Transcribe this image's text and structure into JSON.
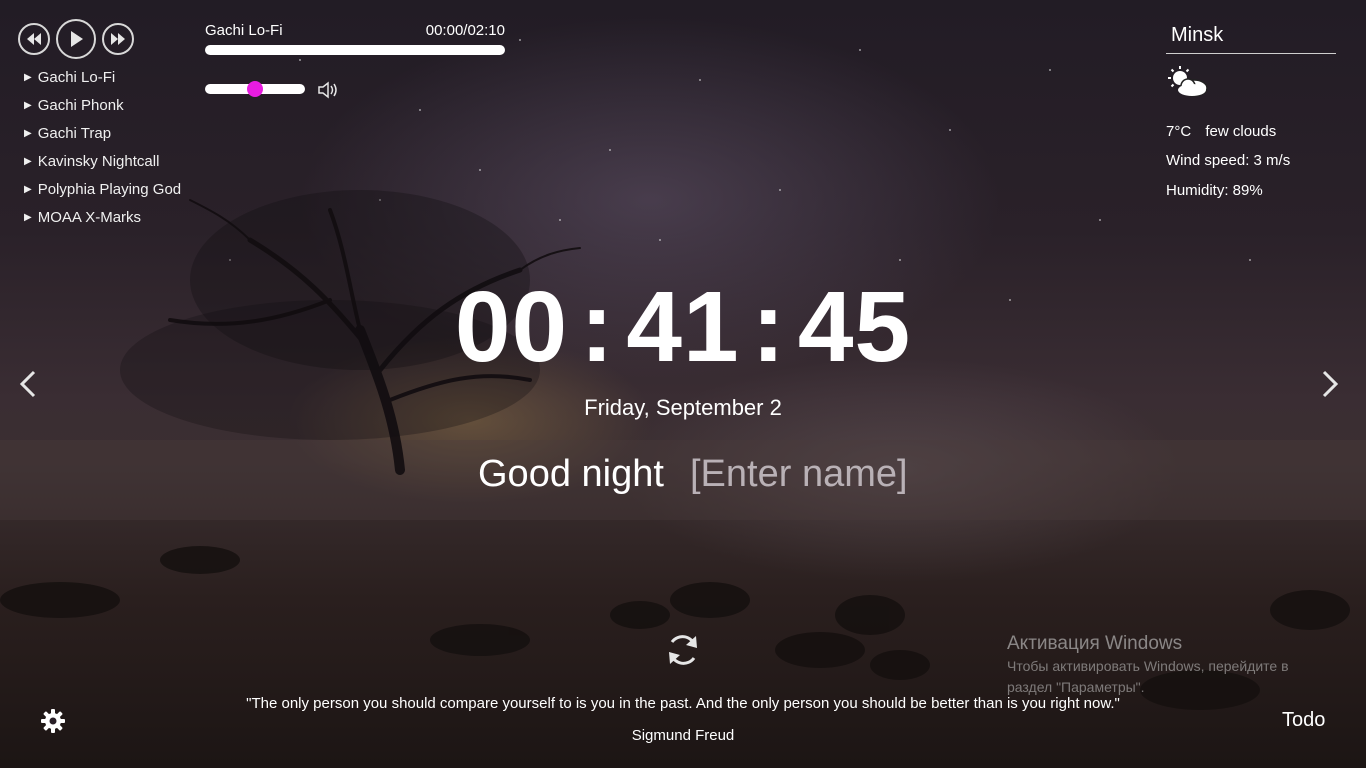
{
  "player": {
    "current_title": "Gachi Lo-Fi",
    "time": "00:00/02:10",
    "progress": 0,
    "volume": 0.5,
    "playlist": [
      {
        "title": "Gachi Lo-Fi"
      },
      {
        "title": "Gachi Phonk"
      },
      {
        "title": "Gachi Trap"
      },
      {
        "title": "Kavinsky Nightcall"
      },
      {
        "title": "Polyphia Playing God"
      },
      {
        "title": "MOAA X-Marks"
      }
    ],
    "icons": [
      "rewind-icon",
      "play-icon",
      "fast-forward-icon",
      "volume-icon"
    ]
  },
  "weather": {
    "city": "Minsk",
    "temperature": "7°C",
    "description": "few clouds",
    "wind": "Wind speed: 3 m/s",
    "humidity": "Humidity: 89%",
    "icon": "sun-behind-clouds-icon"
  },
  "clock": {
    "hours": "00",
    "separator": ":",
    "minutes": "41",
    "seconds": "45"
  },
  "date": "Friday, September 2",
  "greeting": {
    "text": "Good night",
    "name_placeholder": "[Enter name]"
  },
  "quote": {
    "text": "\"The only person you should compare yourself to is you in the past. And the only person you should be better than is you right now.\"",
    "author": "Sigmund Freud"
  },
  "watermark": {
    "title": "Активация Windows",
    "text": "Чтобы активировать Windows, перейдите в раздел \"Параметры\"."
  },
  "todo_label": "Todo",
  "colors": {
    "volume_thumb": "#e81ce0",
    "text": "#ffffff"
  }
}
